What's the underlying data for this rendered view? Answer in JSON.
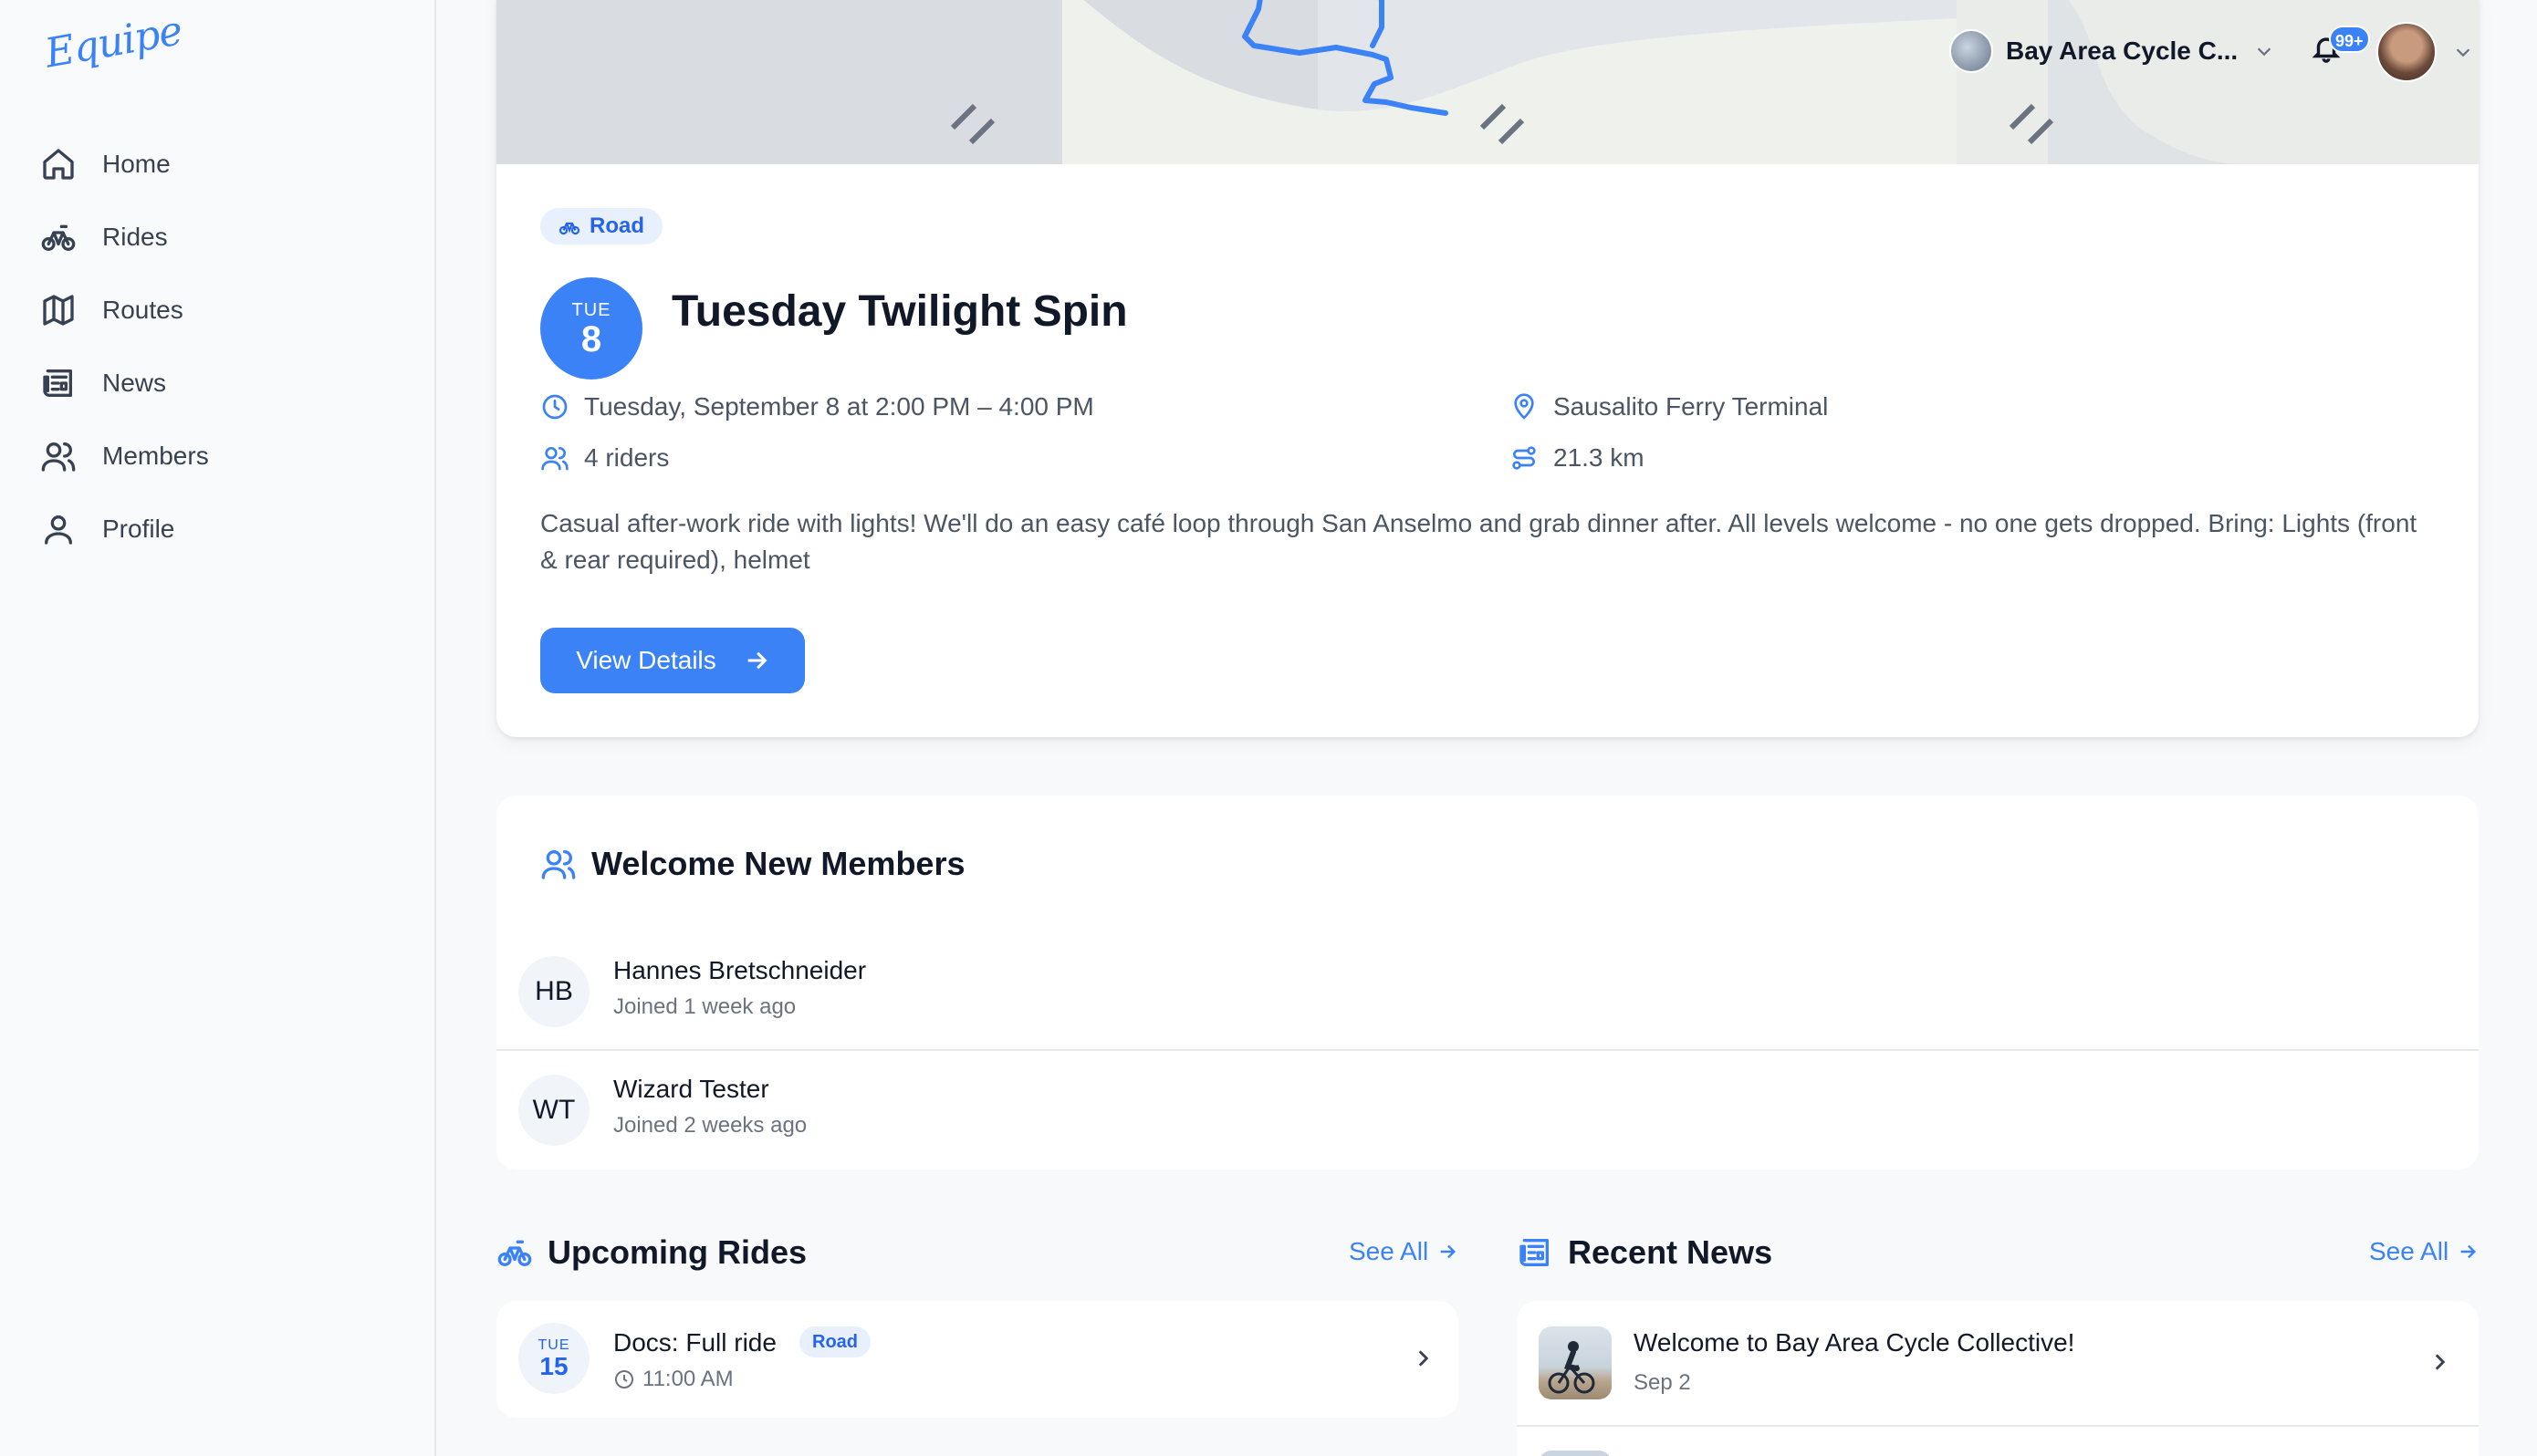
{
  "app": {
    "logo": "Equipe"
  },
  "sidebar": {
    "items": [
      {
        "label": "Home",
        "icon": "home-icon"
      },
      {
        "label": "Rides",
        "icon": "bike-icon"
      },
      {
        "label": "Routes",
        "icon": "map-icon"
      },
      {
        "label": "News",
        "icon": "newspaper-icon"
      },
      {
        "label": "Members",
        "icon": "users-icon"
      },
      {
        "label": "Profile",
        "icon": "user-icon"
      }
    ]
  },
  "topbar": {
    "club_name": "Bay Area Cycle C...",
    "notifications_badge": "99+"
  },
  "featured_event": {
    "tag": "Road",
    "date_dow": "TUE",
    "date_day": "8",
    "title": "Tuesday Twilight Spin",
    "datetime": "Tuesday, September 8 at 2:00 PM – 4:00 PM",
    "location": "Sausalito Ferry Terminal",
    "riders": "4 riders",
    "distance": "21.3 km",
    "description": "Casual after-work ride with lights! We'll do an easy café loop through San Anselmo and grab dinner after. All levels welcome - no one gets dropped. Bring: Lights (front & rear required), helmet",
    "button_label": "View Details"
  },
  "welcome_members": {
    "title": "Welcome New Members",
    "members": [
      {
        "initials": "HB",
        "name": "Hannes Bretschneider",
        "joined": "Joined 1 week ago"
      },
      {
        "initials": "WT",
        "name": "Wizard Tester",
        "joined": "Joined 2 weeks ago"
      }
    ]
  },
  "upcoming_rides": {
    "title": "Upcoming Rides",
    "see_all": "See All",
    "rides": [
      {
        "dow": "TUE",
        "day": "15",
        "title": "Docs: Full ride",
        "tag": "Road",
        "time": "11:00 AM"
      }
    ]
  },
  "recent_news": {
    "title": "Recent News",
    "see_all": "See All",
    "items": [
      {
        "title": "Welcome to Bay Area Cycle Collective!",
        "date": "Sep 2"
      }
    ]
  },
  "colors": {
    "accent": "#3b82f6",
    "route_line": "#3b82f6"
  }
}
